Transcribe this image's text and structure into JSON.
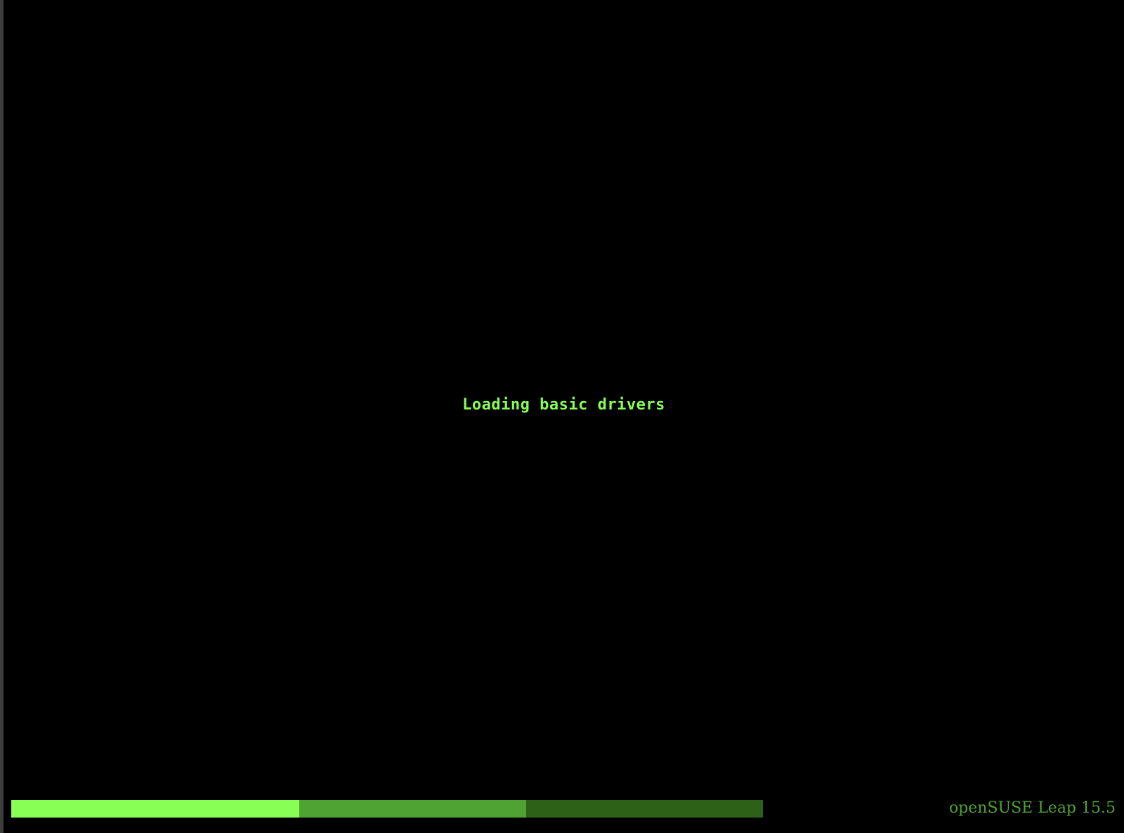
{
  "screen": {
    "status_message": "Loading basic drivers",
    "product_name": "openSUSE Leap 15.5"
  },
  "progress": {
    "completed_fraction": 0.383,
    "secondary_fraction": 0.302,
    "remaining_fraction": 0.315
  },
  "colors": {
    "background": "#000000",
    "text_primary": "#88ff55",
    "progress_done": "#88ff55",
    "progress_mid": "#4ea332",
    "progress_rest": "#2d6118",
    "product_label": "#4ea332"
  }
}
